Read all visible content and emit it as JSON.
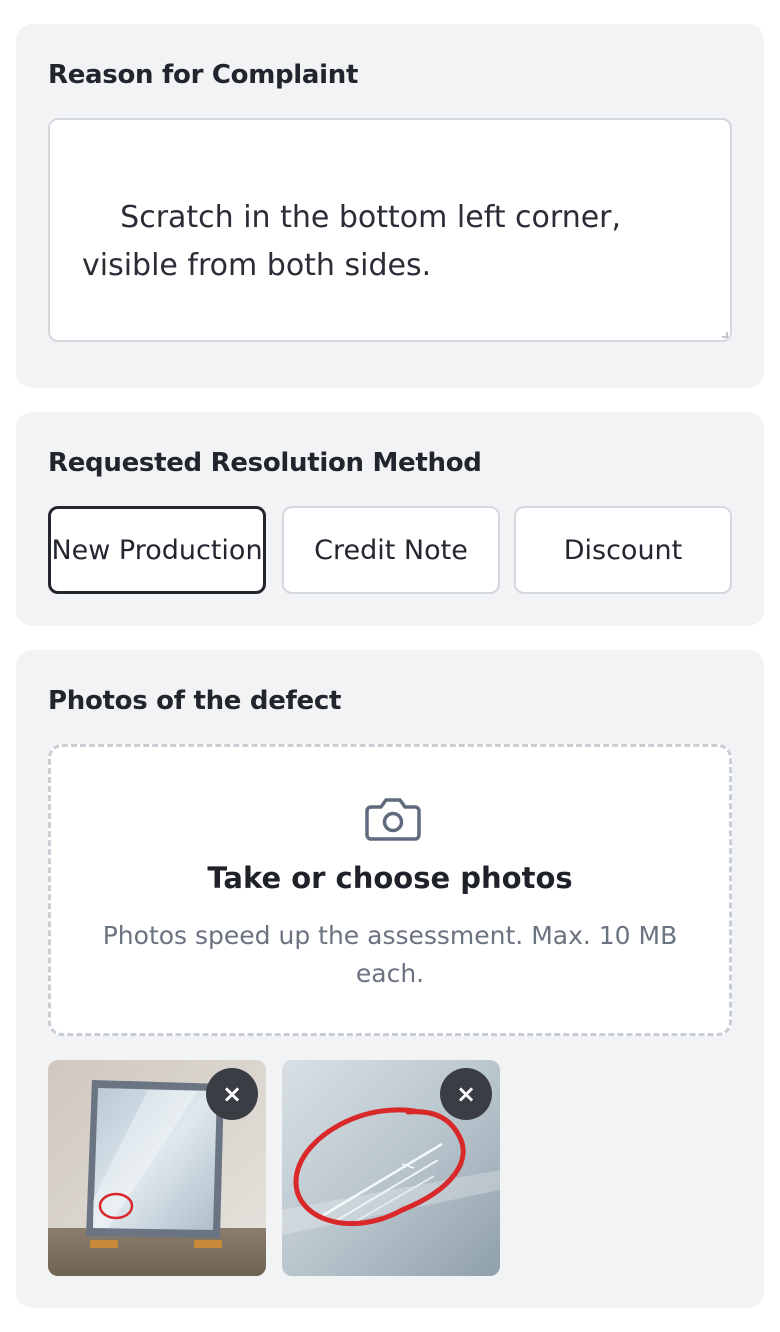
{
  "reason": {
    "title": "Reason for Complaint",
    "text": "Scratch in the bottom left corner, visible from both sides."
  },
  "resolution": {
    "title": "Requested Resolution Method",
    "options": [
      {
        "label": "New Production",
        "selected": true
      },
      {
        "label": "Credit Note",
        "selected": false
      },
      {
        "label": "Discount",
        "selected": false
      }
    ]
  },
  "photos": {
    "title": "Photos of the defect",
    "dropzone_title": "Take or choose photos",
    "dropzone_hint": "Photos speed up the assessment. Max. 10 MB each.",
    "remove_label": "×",
    "icons": {
      "upload": "camera-icon",
      "remove": "close-icon"
    }
  },
  "colors": {
    "card_bg": "#f2f3f5",
    "selected_border": "#23262e",
    "annotation_red": "#d8282a"
  }
}
